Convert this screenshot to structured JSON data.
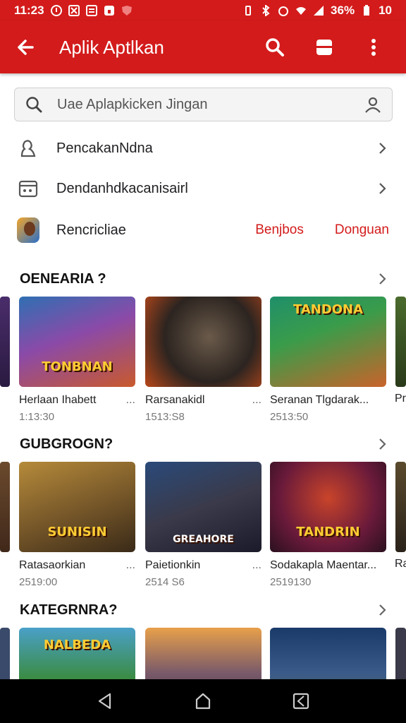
{
  "status_bar": {
    "time": "11:23",
    "battery": "36%",
    "signal_extra": "10"
  },
  "app_bar": {
    "title": "Aplik Aptlkan"
  },
  "search": {
    "placeholder": "Uae Aplapkicken Jingan"
  },
  "menu": [
    {
      "label": "PencakanNdna"
    },
    {
      "label": "Dendanhdkacanisairl"
    },
    {
      "label": "Rencricliae",
      "links": [
        "Benjbos",
        "Donguan"
      ]
    }
  ],
  "sections": [
    {
      "title": "OENEARIA ?",
      "cards": [
        {
          "title": "Herlaan Ihabett",
          "meta": "1:13:30",
          "art": "TONBNAN"
        },
        {
          "title": "Rarsanakidl",
          "meta": "1513:S8",
          "art": ""
        },
        {
          "title": "Seranan Tlgdarak...",
          "meta": "2513:50",
          "art": "TANDONA"
        }
      ],
      "edge_right_text": "Pr"
    },
    {
      "title": "GUBGROGN?",
      "cards": [
        {
          "title": "Ratasaorkian",
          "meta": "2519:00",
          "art": "SUNISIN"
        },
        {
          "title": "Paietionkin",
          "meta": "2514 S6",
          "art": "GREAHORE"
        },
        {
          "title": "Sodakapla Maentar...",
          "meta": "2519130",
          "art": "TANDRIN"
        }
      ],
      "edge_right_text": "Ra"
    },
    {
      "title": "KATEGRNRA?",
      "cards": [
        {
          "title": "",
          "meta": "",
          "art": "NALBEDA"
        },
        {
          "title": "",
          "meta": "",
          "art": ""
        },
        {
          "title": "",
          "meta": "",
          "art": ""
        }
      ]
    }
  ],
  "colors": {
    "accent": "#d31b1b",
    "nav": "#000000"
  }
}
